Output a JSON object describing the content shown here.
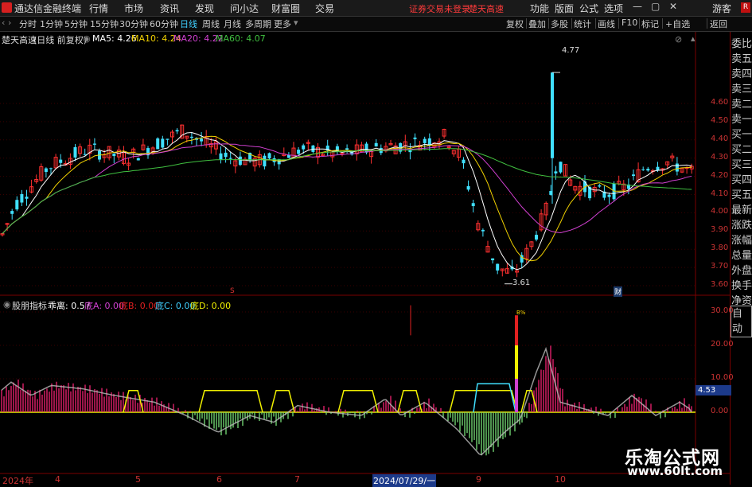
{
  "app": {
    "title": "通达信金融终端"
  },
  "menu": [
    "行情",
    "市场",
    "资讯",
    "发现",
    "问小达",
    "财富圈",
    "交易"
  ],
  "alert": {
    "line1": "证券交易未登录",
    "line2": "楚天高速"
  },
  "right_menu": [
    "功能",
    "版面",
    "公式",
    "选项"
  ],
  "guest": "游客",
  "toolbar": {
    "periods": [
      "分时",
      "1分钟",
      "5分钟",
      "15分钟",
      "30分钟",
      "60分钟",
      "日线",
      "周线",
      "月线",
      "多周期",
      "更多"
    ],
    "active_period": "日线",
    "right": [
      "复权",
      "叠加",
      "多股",
      "统计",
      "画线",
      "F10",
      "标记",
      "+自选",
      "返回"
    ]
  },
  "main": {
    "name": "楚天高速",
    "mode": "(日线 前复权)",
    "ma": [
      {
        "label": "MA5: 4.26",
        "color": "#ffffff"
      },
      {
        "label": "MA10: 4.24",
        "color": "#f0d000"
      },
      {
        "label": "MA20: 4.22",
        "color": "#d040d0"
      },
      {
        "label": "MA60: 4.07",
        "color": "#40c040"
      }
    ],
    "high_label": "4.77",
    "low_label": "3.61",
    "event_marks": [
      "S",
      "财"
    ],
    "axis": [
      "4.60",
      "4.50",
      "4.40",
      "4.30",
      "4.20",
      "4.10",
      "4.00",
      "3.90",
      "3.80",
      "3.70",
      "3.60"
    ],
    "axis_values": [
      4.6,
      4.5,
      4.4,
      4.3,
      4.2,
      4.1,
      4.0,
      3.9,
      3.8,
      3.7,
      3.6
    ]
  },
  "indicator": {
    "name": "股朋指标",
    "items": [
      {
        "label": "乖离: 0.57",
        "color": "#ffffff"
      },
      {
        "label": "底A: 0.00",
        "color": "#d040d0"
      },
      {
        "label": "底B: 0.00",
        "color": "#e02020"
      },
      {
        "label": "底C: 0.00",
        "color": "#40d0ff"
      },
      {
        "label": "底D: 0.00",
        "color": "#f0f000"
      }
    ],
    "axis": [
      "30.00",
      "20.00",
      "10.00",
      "0.00"
    ],
    "axis_values": [
      30,
      20,
      10,
      0
    ],
    "current": "4.53",
    "spike_mark": "B%"
  },
  "xaxis": [
    "2024年",
    "4",
    "5",
    "6",
    "7",
    "2024/07/29/一",
    "9",
    "10"
  ],
  "right_panel": [
    "委比",
    "卖五",
    "卖四",
    "卖三",
    "卖二",
    "卖一",
    "买一",
    "买二",
    "买三",
    "买四",
    "买五",
    "最新",
    "涨跌",
    "涨幅",
    "总量",
    "外盘",
    "换手",
    "净资",
    "收益",
    "自动"
  ],
  "watermark": {
    "title": "乐淘公式网",
    "url": "www.60lt.com"
  },
  "chart_data": {
    "type": "candlestick",
    "title": "楚天高速 (日线 前复权)",
    "ylim": [
      3.58,
      4.82
    ],
    "annotations": [
      {
        "label": "4.77",
        "value": 4.77
      },
      {
        "label": "3.61",
        "value": 3.61
      }
    ],
    "moving_averages": {
      "MA5": 4.26,
      "MA10": 4.24,
      "MA20": 4.22,
      "MA60": 4.07
    },
    "indicator_ylim": [
      -16,
      34
    ]
  }
}
